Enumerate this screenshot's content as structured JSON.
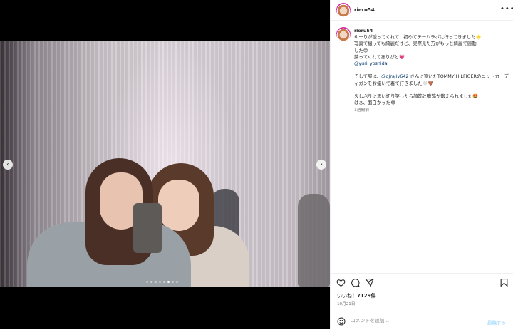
{
  "post": {
    "username": "rieru54",
    "caption": {
      "author": "rieru54",
      "lines": [
        "ゆーりが誘ってくれて、初めてチームラボに行ってきました🌟",
        "写真で撮っても綺麗だけど、実際見た方がもっと綺麗で感動",
        "した😊",
        "誘ってくれてありがと💗",
        "",
        ".",
        "",
        "",
        "久しぶりに思い切り笑ったら顔筋と腹筋が鍛えられました🤩",
        "はぁ、面白かった😂"
      ],
      "mention1": "@yuri_yoshida__",
      "line_prefix": "そして服は、",
      "mention2": "@djrajiv642",
      "line_suffix": " さんに頂いたTOMMY HILFIGERのニットカーディガンをお揃いで着て行きました🤍🤎",
      "time": "1週間前"
    },
    "likes": "いいね！7129件",
    "date": "10月21日",
    "comment_placeholder": "コメントを追加...",
    "post_label": "投稿する"
  },
  "icons": {
    "more": "more-dots-icon",
    "like": "heart-icon",
    "comment": "comment-icon",
    "share": "share-icon",
    "save": "bookmark-icon",
    "emoji": "emoji-icon",
    "prev": "chevron-left-icon",
    "next": "chevron-right-icon"
  },
  "carousel": {
    "count": 8,
    "active_index": 5
  },
  "colors": {
    "link": "#00376b",
    "muted": "#737373",
    "post_button": "#b2dffc"
  }
}
